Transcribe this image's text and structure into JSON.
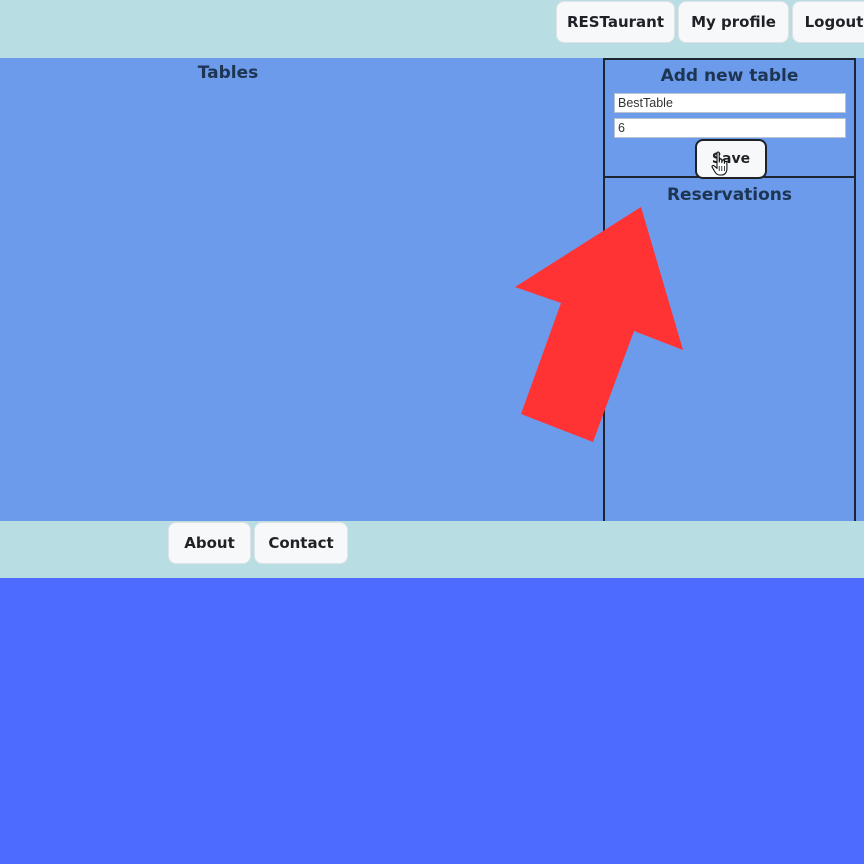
{
  "topnav": {
    "brand_label": "RESTaurant",
    "profile_label": "My profile",
    "logout_label": "Logout"
  },
  "main": {
    "tables_title": "Tables"
  },
  "add_table": {
    "title": "Add new table",
    "name_value": "BestTable",
    "seats_value": "6",
    "save_label": "Save"
  },
  "reservations": {
    "title": "Reservations"
  },
  "footer": {
    "about_label": "About",
    "contact_label": "Contact"
  },
  "colors": {
    "nav_bg": "#b8dde3",
    "main_bg": "#6c9bec",
    "page_bg": "#4d6cff",
    "arrow": "#ff3333"
  },
  "icons": {
    "cursor": "hand-pointer-icon",
    "annotation": "red-arrow-icon"
  }
}
